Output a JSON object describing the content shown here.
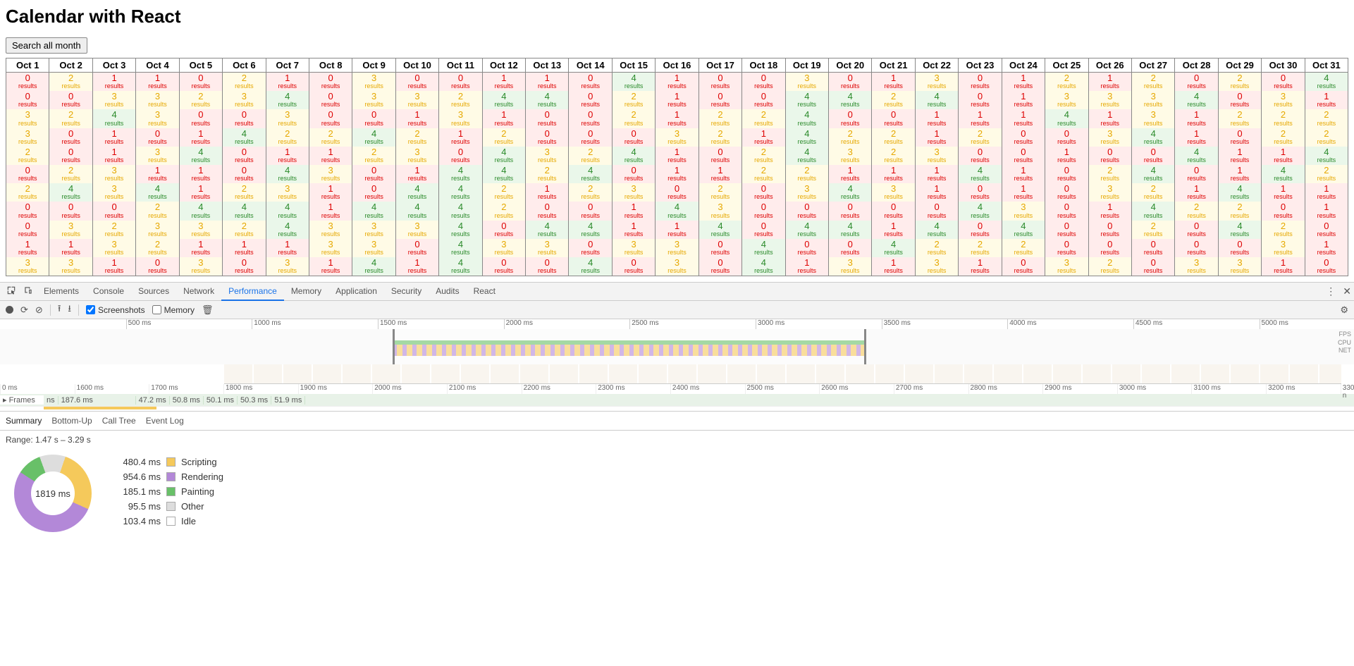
{
  "app": {
    "title": "Calendar with React",
    "search_btn": "Search all month",
    "results_label": "results"
  },
  "calendar": {
    "days": [
      "Oct 1",
      "Oct 2",
      "Oct 3",
      "Oct 4",
      "Oct 5",
      "Oct 6",
      "Oct 7",
      "Oct 8",
      "Oct 9",
      "Oct 10",
      "Oct 11",
      "Oct 12",
      "Oct 13",
      "Oct 14",
      "Oct 15",
      "Oct 16",
      "Oct 17",
      "Oct 18",
      "Oct 19",
      "Oct 20",
      "Oct 21",
      "Oct 22",
      "Oct 23",
      "Oct 24",
      "Oct 25",
      "Oct 26",
      "Oct 27",
      "Oct 28",
      "Oct 29",
      "Oct 30",
      "Oct 31"
    ],
    "rows": [
      [
        0,
        2,
        1,
        1,
        0,
        2,
        1,
        0,
        3,
        0,
        0,
        1,
        1,
        0,
        4,
        1,
        0,
        0,
        3,
        0,
        1,
        3,
        0,
        1,
        2,
        1,
        2,
        0,
        2,
        0,
        4
      ],
      [
        0,
        0,
        3,
        3,
        2,
        3,
        4,
        0,
        3,
        3,
        2,
        4,
        4,
        0,
        2,
        1,
        0,
        0,
        4,
        4,
        2,
        4,
        0,
        1,
        3,
        3,
        3,
        4,
        0,
        3,
        1
      ],
      [
        3,
        2,
        4,
        3,
        0,
        0,
        3,
        0,
        0,
        1,
        3,
        1,
        0,
        0,
        2,
        1,
        2,
        2,
        4,
        0,
        0,
        1,
        1,
        1,
        4,
        1,
        3,
        1,
        2,
        2,
        2
      ],
      [
        3,
        0,
        1,
        0,
        1,
        4,
        2,
        2,
        4,
        2,
        1,
        2,
        0,
        0,
        0,
        3,
        2,
        1,
        4,
        2,
        2,
        1,
        2,
        0,
        0,
        3,
        4,
        1,
        0,
        2,
        2
      ],
      [
        2,
        0,
        1,
        3,
        4,
        0,
        1,
        1,
        2,
        3,
        0,
        4,
        3,
        2,
        4,
        1,
        0,
        2,
        4,
        3,
        2,
        3,
        0,
        0,
        1,
        0,
        0,
        4,
        1,
        1,
        4
      ],
      [
        0,
        2,
        3,
        1,
        1,
        0,
        4,
        3,
        0,
        1,
        4,
        4,
        2,
        4,
        0,
        1,
        1,
        2,
        2,
        1,
        1,
        1,
        4,
        1,
        0,
        2,
        4,
        0,
        1,
        4,
        2
      ],
      [
        2,
        4,
        3,
        4,
        1,
        2,
        3,
        1,
        0,
        4,
        4,
        2,
        1,
        2,
        3,
        0,
        2,
        0,
        3,
        4,
        3,
        1,
        0,
        1,
        0,
        3,
        2,
        1,
        4,
        1,
        1
      ],
      [
        0,
        0,
        0,
        2,
        4,
        4,
        4,
        1,
        4,
        4,
        4,
        2,
        0,
        0,
        1,
        4,
        3,
        0,
        0,
        0,
        0,
        0,
        4,
        3,
        0,
        1,
        4,
        2,
        2,
        0,
        1
      ],
      [
        0,
        3,
        2,
        3,
        3,
        2,
        4,
        3,
        3,
        3,
        4,
        0,
        4,
        4,
        1,
        1,
        4,
        0,
        4,
        4,
        1,
        4,
        0,
        4,
        0,
        0,
        2,
        0,
        4,
        2,
        0
      ],
      [
        1,
        1,
        3,
        2,
        1,
        1,
        1,
        3,
        3,
        0,
        4,
        3,
        3,
        0,
        3,
        3,
        0,
        4,
        0,
        0,
        4,
        2,
        2,
        2,
        0,
        0,
        0,
        0,
        0,
        3,
        1
      ],
      [
        3,
        3,
        1,
        0,
        3,
        0,
        3,
        1,
        4,
        1,
        4,
        0,
        0,
        4,
        0,
        3,
        0,
        4,
        1,
        3,
        1,
        3,
        1,
        0,
        3,
        2,
        0,
        3,
        3,
        1,
        0
      ]
    ]
  },
  "devtools": {
    "tabs": [
      "Elements",
      "Console",
      "Sources",
      "Network",
      "Performance",
      "Memory",
      "Application",
      "Security",
      "Audits",
      "React"
    ],
    "active_tab": "Performance",
    "toolbar": {
      "screenshots_label": "Screenshots",
      "screenshots_checked": true,
      "memory_label": "Memory",
      "memory_checked": false
    },
    "overview_ticks": [
      "500 ms",
      "1000 ms",
      "1500 ms",
      "2000 ms",
      "2500 ms",
      "3000 ms",
      "3500 ms",
      "4000 ms",
      "4500 ms",
      "5000 ms"
    ],
    "overview_labels": [
      "FPS",
      "CPU",
      "NET"
    ],
    "flame_ticks": [
      "0 ms",
      "1600 ms",
      "1700 ms",
      "1800 ms",
      "1900 ms",
      "2000 ms",
      "2100 ms",
      "2200 ms",
      "2300 ms",
      "2400 ms",
      "2500 ms",
      "2600 ms",
      "2700 ms",
      "2800 ms",
      "2900 ms",
      "3000 ms",
      "3100 ms",
      "3200 ms",
      "3300 n"
    ],
    "frames": {
      "label": "▸ Frames",
      "first_partial": "ns",
      "segments": [
        "187.6 ms",
        "47.2 ms",
        "50.8 ms",
        "50.1 ms",
        "50.3 ms",
        "51.9 ms"
      ]
    },
    "sub_tabs": [
      "Summary",
      "Bottom-Up",
      "Call Tree",
      "Event Log"
    ],
    "active_sub_tab": "Summary",
    "range_label": "Range: 1.47 s – 3.29 s",
    "donut_center": "1819 ms",
    "legend": [
      {
        "ms": "480.4 ms",
        "name": "Scripting",
        "cls": "sw-script"
      },
      {
        "ms": "954.6 ms",
        "name": "Rendering",
        "cls": "sw-render"
      },
      {
        "ms": "185.1 ms",
        "name": "Painting",
        "cls": "sw-paint"
      },
      {
        "ms": "95.5 ms",
        "name": "Other",
        "cls": "sw-other"
      },
      {
        "ms": "103.4 ms",
        "name": "Idle",
        "cls": "sw-idle"
      }
    ]
  },
  "chart_data": {
    "type": "pie",
    "title": "Performance Summary 1819 ms",
    "series": [
      {
        "name": "Scripting",
        "value": 480.4,
        "unit": "ms"
      },
      {
        "name": "Rendering",
        "value": 954.6,
        "unit": "ms"
      },
      {
        "name": "Painting",
        "value": 185.1,
        "unit": "ms"
      },
      {
        "name": "Other",
        "value": 95.5,
        "unit": "ms"
      },
      {
        "name": "Idle",
        "value": 103.4,
        "unit": "ms"
      }
    ],
    "total": "1819 ms",
    "range": "1.47 s – 3.29 s"
  }
}
